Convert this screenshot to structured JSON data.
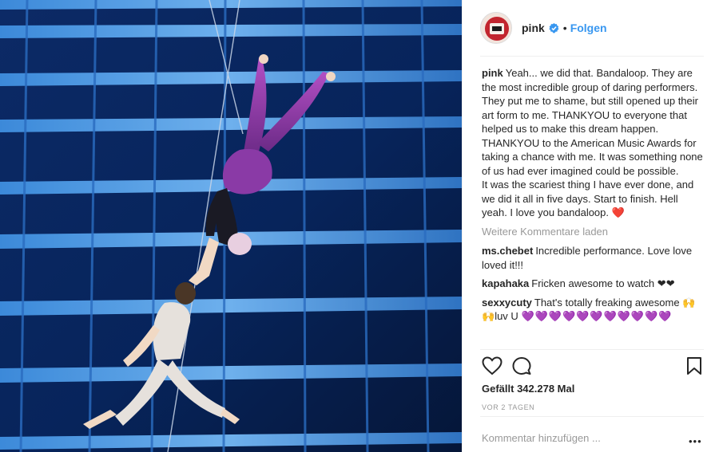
{
  "post": {
    "username": "pink",
    "follow_label": "Folgen",
    "dot": "•",
    "caption_lines": [
      "Yeah... we did that. Bandaloop. They are the most incredible group of daring performers. They put me to shame, but still opened up their art form to me. THANKYOU to everyone that helped us to make this dream happen. THANKYOU to the American Music Awards for taking a chance with me. It was something none of us had ever imagined could be possible.",
      "It was the scariest thing I have ever done, and we did it all in five days. Start to finish. Hell yeah. I love you bandaloop."
    ],
    "caption_emoji": "❤️",
    "load_more_label": "Weitere Kommentare laden",
    "comments": [
      {
        "user": "ms.chebet",
        "text": "Incredible performance. Love love loved it!!!"
      },
      {
        "user": "kapahaka",
        "text": "Fricken awesome to watch",
        "emoji": "❤❤"
      },
      {
        "user": "sexxycuty",
        "text": "That's totally freaking awesome",
        "emoji_pre": "🙌🙌",
        "text2": "luv U",
        "emoji_post": "💜💜💜💜💜💜💜💜💜💜💜"
      }
    ],
    "likes_label": "Gefällt 342.278 Mal",
    "time_label": "VOR 2 TAGEN",
    "comment_placeholder": "Kommentar hinzufügen ...",
    "options_label": "•••"
  },
  "icons": {
    "verified": "verified-badge-icon",
    "like": "heart-outline-icon",
    "comment": "speech-bubble-icon",
    "save": "bookmark-icon",
    "more": "more-options-icon"
  },
  "colors": {
    "link_blue": "#3897f0",
    "text": "#262626",
    "muted": "#999999",
    "divider": "#efefef",
    "heart_red": "#ed1c24",
    "purple_heart": "#a35bd8",
    "photo_bg": "#071a44"
  }
}
